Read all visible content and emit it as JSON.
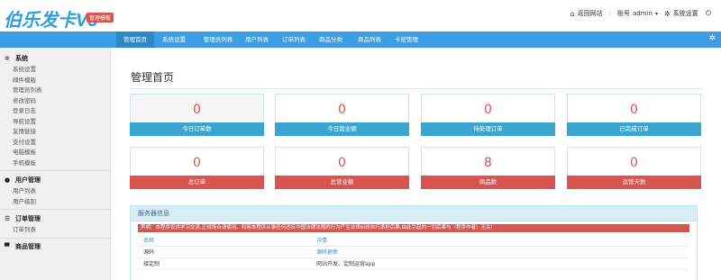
{
  "app": {
    "logo": "伯乐发卡V3",
    "badge": "管理模板"
  },
  "topbar": {
    "home_icon": "home-icon",
    "home_label": "返回网站",
    "account_prefix": "账号",
    "account_user": "admin",
    "settings_icon": "gear-icon",
    "settings_label": "系统设置",
    "logout_icon": "power-icon"
  },
  "nav": {
    "items": [
      {
        "label": "管理首页",
        "active": true
      },
      {
        "label": "系统设置"
      },
      {
        "label": "管理员列表"
      },
      {
        "label": "用户列表"
      },
      {
        "label": "订单列表"
      },
      {
        "label": "商品分类"
      },
      {
        "label": "商品列表"
      },
      {
        "label": "卡密管理"
      }
    ]
  },
  "sidebar": {
    "groups": [
      {
        "icon": "gear-icon",
        "title": "系统",
        "items": [
          "系统设置",
          "邮件模版",
          "管理员列表",
          "修改密码",
          "登录日志",
          "导航设置",
          "友情链接",
          "支付设置",
          "电脑模板",
          "手机模板"
        ]
      },
      {
        "icon": "user-icon",
        "title": "用户管理",
        "items": [
          "用户列表",
          "用户级别"
        ]
      },
      {
        "icon": "list-icon",
        "title": "订单管理",
        "items": [
          "订单列表"
        ]
      },
      {
        "icon": "cart-icon",
        "title": "商品管理",
        "items": []
      }
    ]
  },
  "main": {
    "title": "管理首页",
    "stats": [
      {
        "value": "0",
        "label": "今日订单数"
      },
      {
        "value": "0",
        "label": "今日营业额"
      },
      {
        "value": "0",
        "label": "待处理订单"
      },
      {
        "value": "0",
        "label": "已完成订单"
      },
      {
        "value": "0",
        "label": "总订单"
      },
      {
        "value": "0",
        "label": "总营业额"
      },
      {
        "value": "8",
        "label": "商品数"
      },
      {
        "value": "0",
        "label": "运营天数"
      }
    ],
    "server_panel": {
      "title": "服务器信息",
      "notice": "声明：本程序仅供学习交流,正规场合请使用。利用本程序从事任何违反中国法律法规的行为产生法律纠纷自行承担后果,由此引起的一切后果与（程序作者）无关!",
      "col_name": "名称",
      "col_detail": "详情",
      "rows": [
        {
          "name": "源码",
          "detail": "源码更新"
        },
        {
          "name": "接定制",
          "detail": "网站开发、定制运营app"
        }
      ]
    }
  },
  "colors": {
    "brand": "#3c9de3",
    "stat_blue": "#3aa6d0",
    "stat_red": "#d9534f",
    "panel_head": "#d9edf7"
  }
}
